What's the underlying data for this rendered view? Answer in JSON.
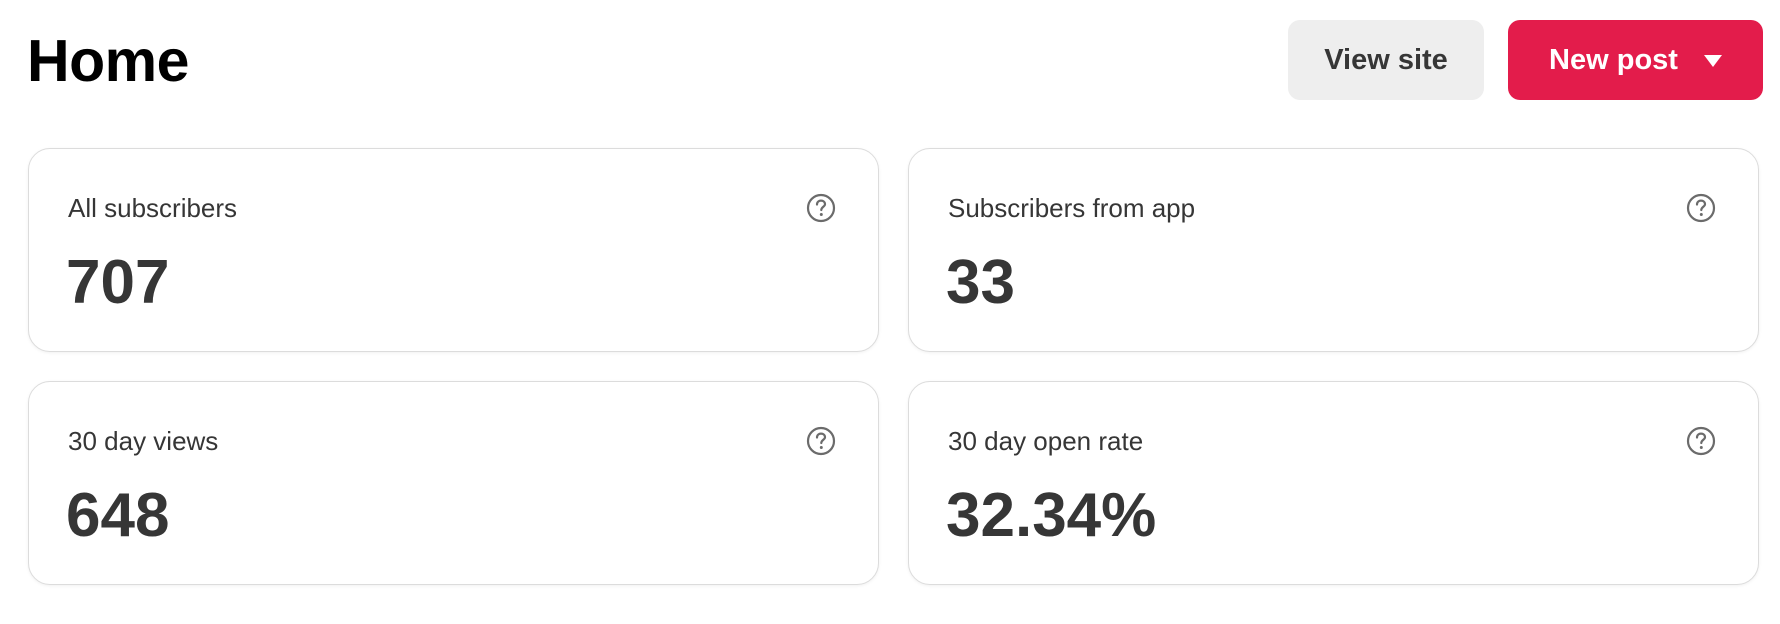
{
  "header": {
    "title": "Home",
    "view_site_label": "View site",
    "new_post_label": "New post",
    "new_post_icon": "caret-down-icon"
  },
  "colors": {
    "accent": "#e31c4b",
    "secondary_button_bg": "#eeeeee",
    "text": "#363636",
    "card_border": "#dcdcdc"
  },
  "stats": [
    {
      "label": "All subscribers",
      "value": "707",
      "icon": "help-icon"
    },
    {
      "label": "Subscribers from app",
      "value": "33",
      "icon": "help-icon"
    },
    {
      "label": "30 day views",
      "value": "648",
      "icon": "help-icon"
    },
    {
      "label": "30 day open rate",
      "value": "32.34%",
      "icon": "help-icon"
    }
  ]
}
